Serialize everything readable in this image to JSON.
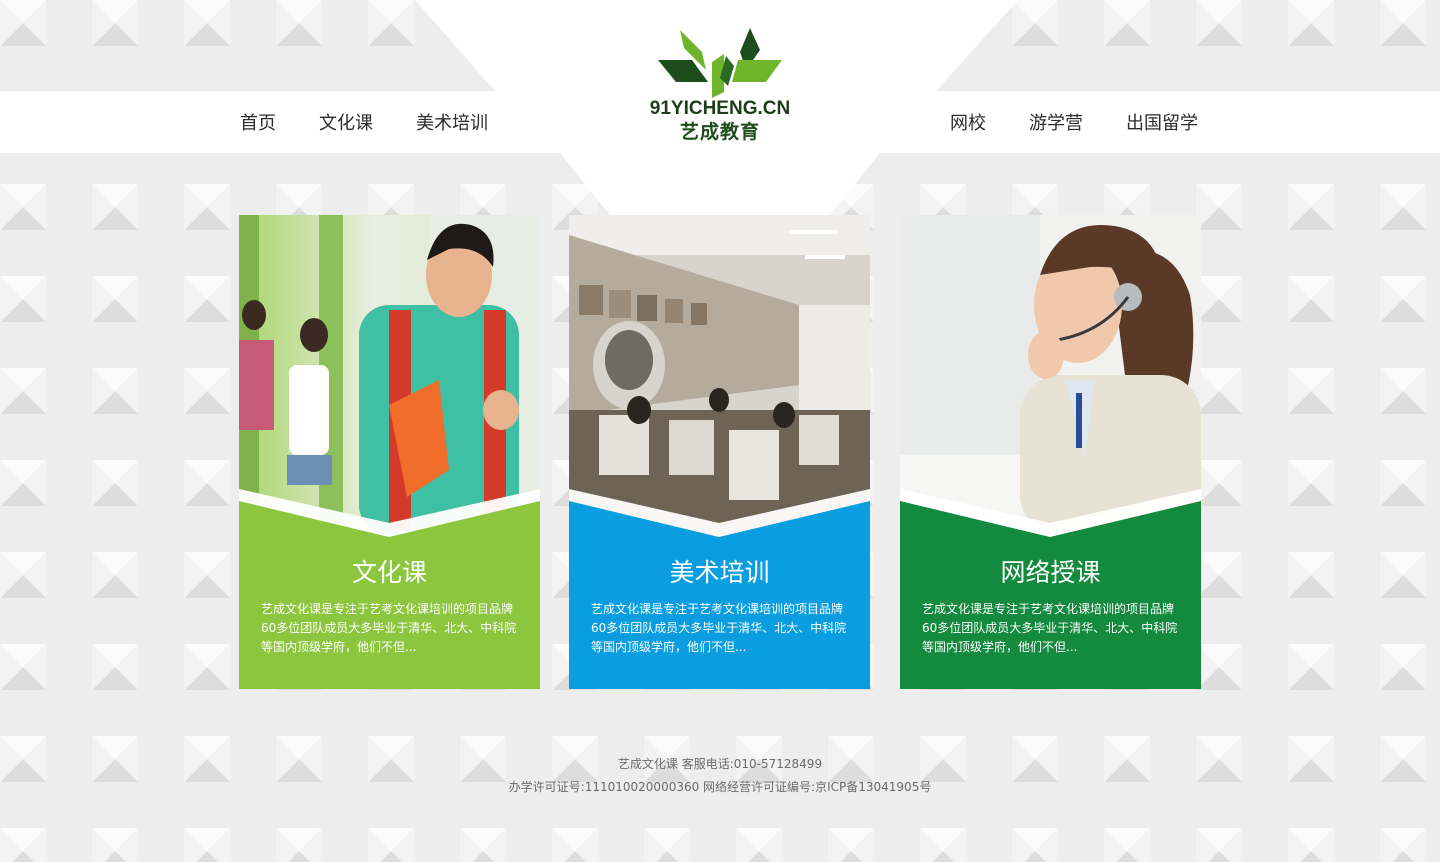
{
  "nav": {
    "left": [
      {
        "label": "首页"
      },
      {
        "label": "文化课"
      },
      {
        "label": "美术培训"
      }
    ],
    "right": [
      {
        "label": "网校"
      },
      {
        "label": "游学营"
      },
      {
        "label": "出国留学"
      }
    ]
  },
  "logo": {
    "domain": "91YICHENG.CN",
    "name_cn": "艺成教育",
    "colors": {
      "dark": "#1e4d1c",
      "light": "#6fb52c"
    }
  },
  "cards": [
    {
      "title": "文化课",
      "description": "艺成文化课是专注于艺考文化课培训的项目品牌60多位团队成员大多毕业于清华、北大、中科院等国内顶级学府，他们不但...",
      "color": "#8cc63f",
      "photo": "student-with-backpack"
    },
    {
      "title": "美术培训",
      "description": "艺成文化课是专注于艺考文化课培训的项目品牌60多位团队成员大多毕业于清华、北大、中科院等国内顶级学府，他们不但...",
      "color": "#0a9de0",
      "photo": "art-studio-sketching"
    },
    {
      "title": "网络授课",
      "description": "艺成文化课是专注于艺考文化课培训的项目品牌60多位团队成员大多毕业于清华、北大、中科院等国内顶级学府，他们不但...",
      "color": "#138a3e",
      "photo": "customer-service-headset"
    }
  ],
  "footer": {
    "line1": "艺成文化课 客服电话:010-57128499",
    "line2": "办学许可证号:111010020000360 网络经营许可证编号:京ICP备13041905号"
  }
}
